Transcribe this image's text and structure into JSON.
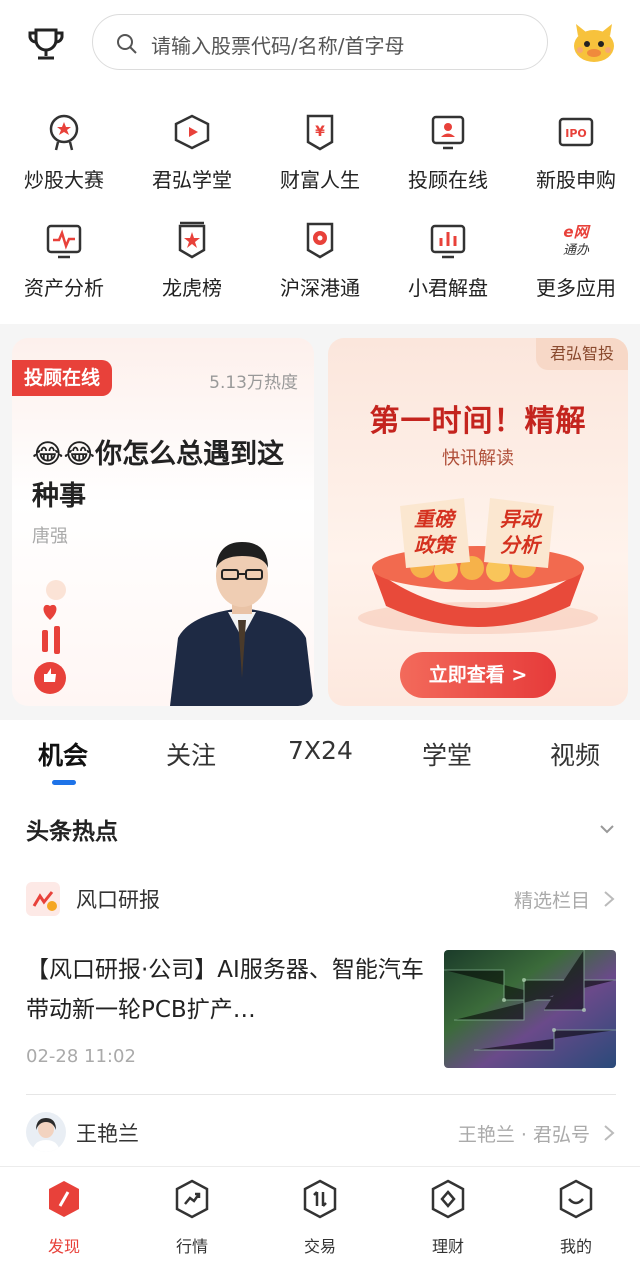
{
  "header": {
    "search_placeholder": "请输入股票代码/名称/首字母"
  },
  "grid": {
    "items": [
      {
        "label": "炒股大赛",
        "icon": "medal-icon"
      },
      {
        "label": "君弘学堂",
        "icon": "school-play-icon"
      },
      {
        "label": "财富人生",
        "icon": "wealth-icon"
      },
      {
        "label": "投顾在线",
        "icon": "advisor-icon"
      },
      {
        "label": "新股申购",
        "icon": "ipo-icon"
      },
      {
        "label": "资产分析",
        "icon": "asset-analysis-icon"
      },
      {
        "label": "龙虎榜",
        "icon": "dragon-tiger-list-icon"
      },
      {
        "label": "沪深港通",
        "icon": "stock-connect-icon"
      },
      {
        "label": "小君解盘",
        "icon": "market-review-icon"
      },
      {
        "label": "更多应用",
        "icon": "e-net-apps-icon",
        "icon_text_top": "e网",
        "icon_text_bottom": "通办"
      }
    ]
  },
  "banner_left": {
    "badge": "投顾在线",
    "heat": "5.13万热度",
    "title": "😂😂你怎么总遇到这种事",
    "author": "唐强"
  },
  "banner_right": {
    "badge": "君弘智投",
    "title": "第一时间！精解",
    "subtitle": "快讯解读",
    "tag1_line1": "重磅",
    "tag1_line2": "政策",
    "tag2_line1": "异动",
    "tag2_line2": "分析",
    "button": "立即查看 >"
  },
  "tabs": [
    {
      "label": "机会",
      "active": true
    },
    {
      "label": "关注",
      "active": false
    },
    {
      "label": "7X24",
      "active": false
    },
    {
      "label": "学堂",
      "active": false
    },
    {
      "label": "视频",
      "active": false
    }
  ],
  "feed": {
    "section_title": "头条热点",
    "source": {
      "name": "风口研报",
      "tag": "精选栏目"
    },
    "news": {
      "title": "【风口研报·公司】AI服务器、智能汽车带动新一轮PCB扩产…",
      "time": "02-28 11:02"
    },
    "author": {
      "name": "王艳兰",
      "tag": "王艳兰 · 君弘号"
    }
  },
  "bottom_nav": [
    {
      "label": "发现",
      "icon": "discover-icon",
      "active": true
    },
    {
      "label": "行情",
      "icon": "market-icon",
      "active": false
    },
    {
      "label": "交易",
      "icon": "trade-icon",
      "active": false
    },
    {
      "label": "理财",
      "icon": "finance-icon",
      "active": false
    },
    {
      "label": "我的",
      "icon": "profile-icon",
      "active": false
    }
  ],
  "colors": {
    "accent_red": "#e8413a",
    "tab_underline_blue": "#1e73e8"
  }
}
